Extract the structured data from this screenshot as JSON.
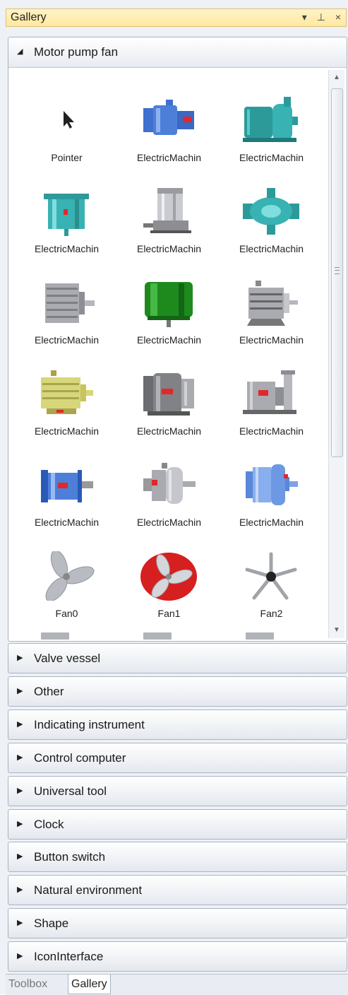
{
  "window": {
    "title": "Gallery",
    "controls": [
      "▾",
      "⊥",
      "×"
    ]
  },
  "open_group": {
    "label": "Motor pump fan",
    "items": [
      {
        "name": "Pointer",
        "icon": "pointer-icon"
      },
      {
        "name": "ElectricMachin",
        "icon": "motor-blue-icon"
      },
      {
        "name": "ElectricMachin",
        "icon": "pump-teal-icon"
      },
      {
        "name": "ElectricMachin",
        "icon": "motor-teal-vertical-icon"
      },
      {
        "name": "ElectricMachin",
        "icon": "motor-gray-vertical-icon"
      },
      {
        "name": "ElectricMachin",
        "icon": "pump-teal-round-icon"
      },
      {
        "name": "ElectricMachin",
        "icon": "motor-gray-icon"
      },
      {
        "name": "ElectricMachin",
        "icon": "motor-green-icon"
      },
      {
        "name": "ElectricMachin",
        "icon": "motor-gray-small-icon"
      },
      {
        "name": "ElectricMachin",
        "icon": "motor-yellow-icon"
      },
      {
        "name": "ElectricMachin",
        "icon": "motor-dark-gray-icon"
      },
      {
        "name": "ElectricMachin",
        "icon": "pump-gray-icon"
      },
      {
        "name": "ElectricMachin",
        "icon": "motor-blue-flange-icon"
      },
      {
        "name": "ElectricMachin",
        "icon": "gearmotor-gray-icon"
      },
      {
        "name": "ElectricMachin",
        "icon": "gearmotor-blue-icon"
      },
      {
        "name": "Fan0",
        "icon": "fan-gray-icon"
      },
      {
        "name": "Fan1",
        "icon": "fan-red-icon"
      },
      {
        "name": "Fan2",
        "icon": "fan-spokes-icon"
      }
    ]
  },
  "groups": [
    "Valve vessel",
    "Other",
    "Indicating instrument",
    "Control computer",
    "Universal tool",
    "Clock",
    "Button switch",
    "Natural environment",
    "Shape",
    "IconInterface"
  ],
  "tabs": [
    {
      "label": "Toolbox",
      "active": false
    },
    {
      "label": "Gallery",
      "active": true
    }
  ],
  "colors": {
    "title_bar": "#ffe8a0",
    "motor_blue": "#4d7fd9",
    "pump_teal": "#38b2b2",
    "motor_green": "#1e8a1e",
    "motor_gray": "#a9abb0",
    "motor_yellow": "#d8d67a",
    "fan_red": "#d61f1f",
    "accent_red": "#e0282a"
  }
}
